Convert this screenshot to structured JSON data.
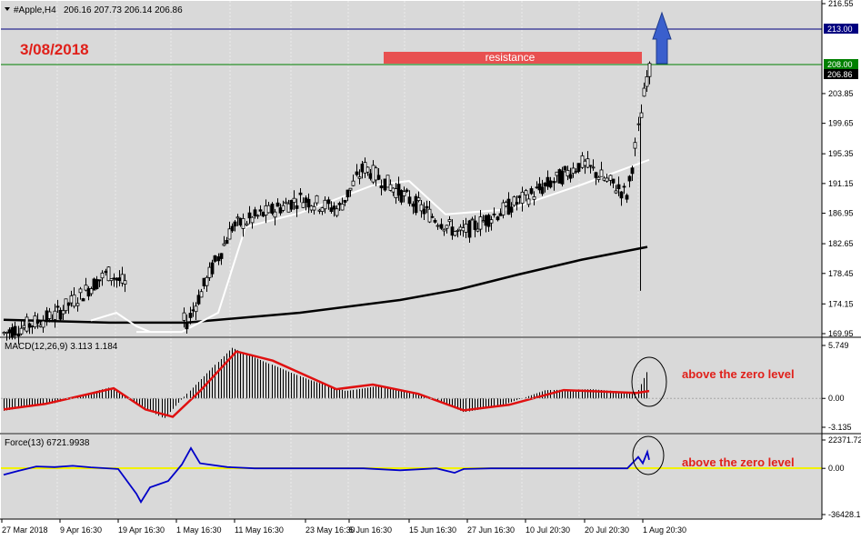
{
  "header": {
    "symbol_text": "#Apple,H4",
    "ohlc_text": "206.16 207.73 206.14 206.86"
  },
  "annotations": {
    "date_label": "3/08/2018",
    "resistance_label": "resistance",
    "macd_note": "above the zero level",
    "force_note": "above the zero level"
  },
  "colors": {
    "background": "#d9d9d9",
    "grid": "#ececec",
    "candle": "#000000",
    "ma_slow": "#000000",
    "ma_fast": "#ffffff",
    "macd_signal": "#e01010",
    "force_line": "#0000c8",
    "zero_line": "#f2f200",
    "resistance_box": "#e85050",
    "arrow": "#3a5fcd",
    "h_line_blue": "#000080",
    "h_line_green": "#008000",
    "annotation_text": "#e0201a"
  },
  "price_axis": {
    "ticks": [
      "216.55",
      "213.00",
      "208.00",
      "206.86",
      "203.85",
      "199.65",
      "195.35",
      "191.15",
      "186.95",
      "182.65",
      "178.45",
      "174.15",
      "169.95"
    ],
    "level_213_label": "213.00",
    "level_208_label": "208.00",
    "current_label": "206.86"
  },
  "macd_axis": {
    "panel_label": "MACD(12,26,9) 3.113 1.184",
    "ticks": [
      "5.749",
      "0.00",
      "-3.135"
    ]
  },
  "force_axis": {
    "panel_label": "Force(13) 6721.9938",
    "ticks": [
      "22371.72",
      "0.00",
      "-36428.1"
    ]
  },
  "time_axis": {
    "labels": [
      "27 Mar 2018",
      "9 Apr 16:30",
      "19 Apr 16:30",
      "1 May 16:30",
      "11 May 16:30",
      "23 May 16:30",
      "5 Jun 16:30",
      "15 Jun 16:30",
      "27 Jun 16:30",
      "10 Jul 20:30",
      "20 Jul 20:30",
      "1 Aug 20:30"
    ]
  },
  "chart_data": {
    "type": "candlestick",
    "symbol": "#Apple",
    "timeframe": "H4",
    "price_range": [
      169.95,
      216.55
    ],
    "levels": {
      "resistance": 208.0,
      "target": 213.0,
      "current": 206.86
    },
    "price_path": {
      "x": [
        "27 Mar 2018",
        "9 Apr 16:30",
        "19 Apr 16:30",
        "1 May 16:30",
        "11 May 16:30",
        "23 May 16:30",
        "5 Jun 16:30",
        "15 Jun 16:30",
        "27 Jun 16:30",
        "10 Jul 20:30",
        "20 Jul 20:30",
        "1 Aug 20:30"
      ],
      "close": [
        170.0,
        172.5,
        178.5,
        171.5,
        185.0,
        189.0,
        187.5,
        193.5,
        187.0,
        184.0,
        190.0,
        194.0,
        189.5,
        207.0
      ]
    },
    "moving_average_slow": [
      171.9,
      171.5,
      172.9,
      174.7,
      176.2,
      178.3,
      180.4,
      182.2
    ],
    "moving_average_fast": [
      170.2,
      172.9,
      178.5,
      187.0,
      188.1,
      190.9,
      186.8,
      188.5,
      192.6
    ],
    "macd": {
      "range": [
        -3.135,
        5.749
      ],
      "current_hist": 3.113,
      "current_signal": 1.184,
      "histogram_peak": 5.5,
      "signal_peak": 5.1,
      "signal_low": -2.2
    },
    "force_index": {
      "range": [
        -36428.1,
        22371.72
      ],
      "current": 6721.9938,
      "low": -26500,
      "high": 16000
    }
  }
}
